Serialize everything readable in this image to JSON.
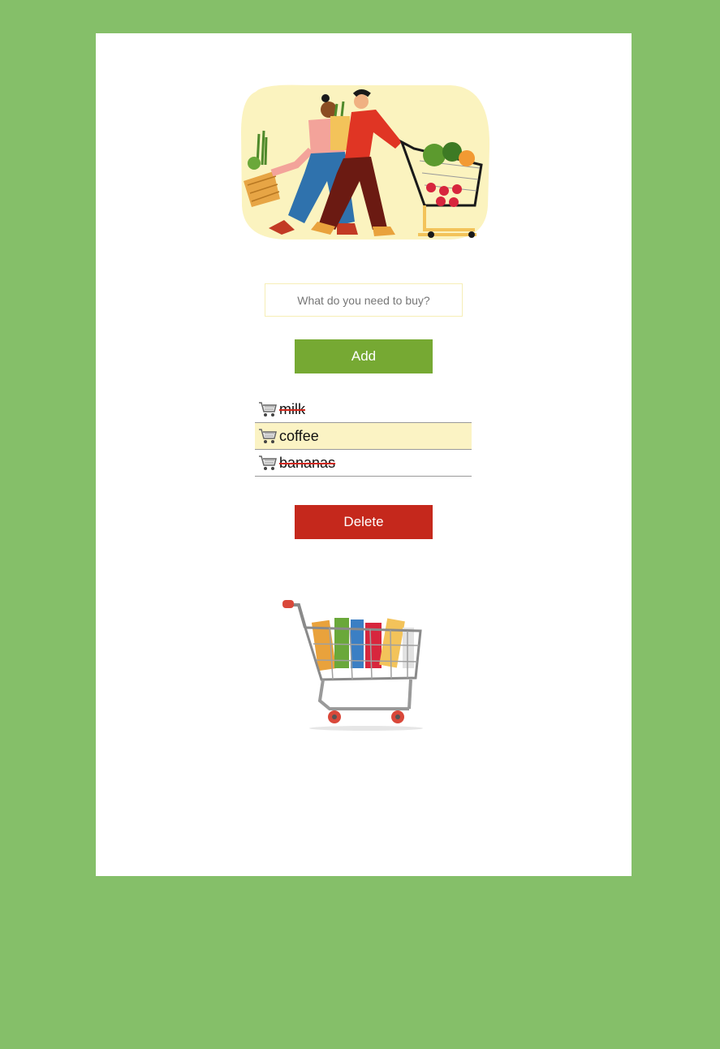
{
  "app": {
    "background_color": "#85bf69",
    "card_color": "#ffffff"
  },
  "hero": {
    "icon": "shopping-couple-illustration"
  },
  "search": {
    "placeholder": "What do you need to buy?",
    "value": ""
  },
  "actions": {
    "add_label": "Add",
    "delete_label": "Delete",
    "add_color": "#76a933",
    "delete_color": "#c5281c"
  },
  "list": {
    "items": [
      {
        "label": "milk",
        "done": true,
        "selected": false,
        "icon": "shopping-cart-icon"
      },
      {
        "label": "coffee",
        "done": false,
        "selected": true,
        "icon": "shopping-cart-icon"
      },
      {
        "label": "bananas",
        "done": true,
        "selected": false,
        "icon": "shopping-cart-icon"
      }
    ],
    "selected_color": "#fbf3c4"
  },
  "footer": {
    "icon": "shopping-cart-full-illustration"
  }
}
